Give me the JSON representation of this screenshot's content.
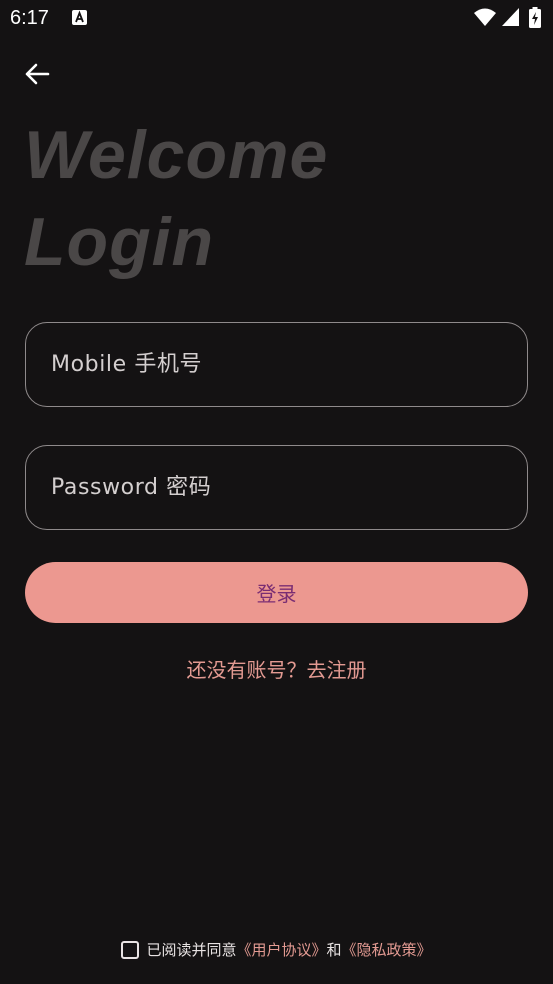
{
  "status_bar": {
    "time": "6:17",
    "icons": [
      "a-notification-icon",
      "wifi-icon",
      "cell-signal-icon",
      "battery-charging-icon"
    ]
  },
  "header": {
    "back_icon": "arrow-left-icon",
    "title_line1": "Welcome",
    "title_line2": "Login"
  },
  "form": {
    "mobile_placeholder": "Mobile 手机号",
    "mobile_value": "",
    "password_placeholder": "Password 密码",
    "password_value": "",
    "login_label": "登录",
    "register_link": "还没有账号？去注册"
  },
  "agreement": {
    "checked": false,
    "prefix": "已阅读并同意",
    "user_agreement": "《用户协议》",
    "conjunction": "和",
    "privacy_policy": "《隐私政策》"
  },
  "colors": {
    "background": "#141213",
    "title": "#4a4747",
    "button_bg": "#ec9890",
    "button_text": "#7a2d73",
    "link": "#e39a92",
    "field_border": "#8f8a8b"
  }
}
